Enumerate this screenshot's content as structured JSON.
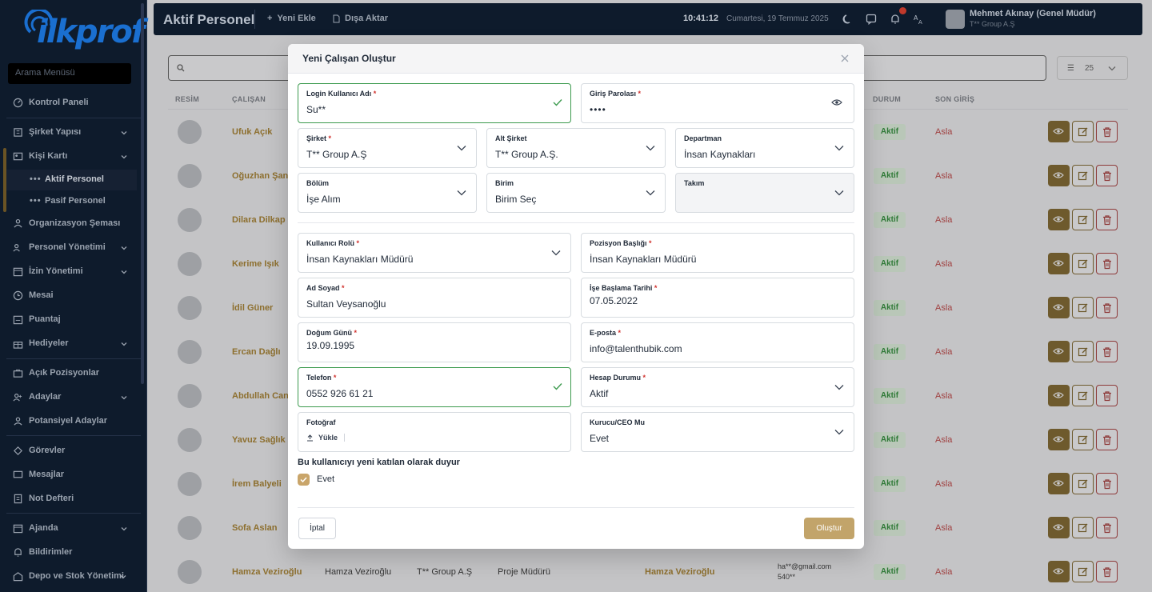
{
  "sidebar": {
    "logo_text": "ilkprof",
    "search_placeholder": "Arama Menüsü",
    "items": [
      {
        "label": "Kontrol Paneli",
        "icon": "dashboard-icon"
      },
      {
        "label": "Şirket Yapısı",
        "icon": "building-icon"
      },
      {
        "label": "Kişi Kartı",
        "icon": "user-card-icon"
      },
      {
        "label": "Aktif Personel"
      },
      {
        "label": "Pasif Personel"
      },
      {
        "label": "Organizasyon Şeması",
        "icon": "org-chart-icon"
      },
      {
        "label": "Personel Yönetimi",
        "icon": "users-icon"
      },
      {
        "label": "İzin Yönetimi",
        "icon": "calendar-icon"
      },
      {
        "label": "Mesai",
        "icon": "clock-icon"
      },
      {
        "label": "Puantaj",
        "icon": "timesheet-icon"
      },
      {
        "label": "Hediyeler",
        "icon": "gift-icon"
      },
      {
        "label": "Açık Pozisyonlar",
        "icon": "briefcase-icon"
      },
      {
        "label": "Adaylar",
        "icon": "candidates-icon"
      },
      {
        "label": "Potansiyel Adaylar",
        "icon": "potential-icon"
      },
      {
        "label": "Görevler",
        "icon": "tasks-icon"
      },
      {
        "label": "Mesajlar",
        "icon": "messages-icon"
      },
      {
        "label": "Not Defteri",
        "icon": "notebook-icon"
      },
      {
        "label": "Ajanda",
        "icon": "agenda-icon"
      },
      {
        "label": "Bildirimler",
        "icon": "bell-icon"
      },
      {
        "label": "Depo ve Stok Yönetimi",
        "icon": "warehouse-icon"
      }
    ]
  },
  "topbar": {
    "title": "Aktif Personel",
    "new_label": "Yeni Ekle",
    "export_label": "Dışa Aktar",
    "time": "10:41:12",
    "date": "Cumartesi, 19 Temmuz 2025",
    "user_name": "Mehmet Akınay (Genel Müdür)",
    "user_company": "T** Group A.Ş"
  },
  "table": {
    "page_size": "25",
    "headers": {
      "photo": "RESİM",
      "employee": "ÇALIŞAN",
      "status": "DURUM",
      "last_login": "SON GİRİŞ"
    },
    "rows": [
      {
        "name": "Ufuk Açık",
        "status": "Aktif",
        "last_login": "Asla"
      },
      {
        "name": "Oğuzhan Şan",
        "status": "Aktif",
        "last_login": "Asla"
      },
      {
        "name": "Dilara Dilkap",
        "status": "Aktif",
        "last_login": "Asla"
      },
      {
        "name": "Kerime Işık",
        "status": "Aktif",
        "last_login": "Asla"
      },
      {
        "name": "İdil Güner",
        "status": "Aktif",
        "last_login": "Asla"
      },
      {
        "name": "Ercan Dağlı",
        "status": "Aktif",
        "last_login": "Asla"
      },
      {
        "name": "Abdullah Can",
        "status": "Aktif",
        "last_login": "Asla"
      },
      {
        "name": "Yavuz Sağlık",
        "status": "Aktif",
        "last_login": "Asla"
      },
      {
        "name": "İrem Balyeli",
        "status": "Aktif",
        "last_login": "Asla"
      },
      {
        "name": "Sofa Aslan",
        "status": "Aktif",
        "last_login": "Asla"
      },
      {
        "name": "Hamza Veziroğlu",
        "status": "Aktif",
        "last_login": "Asla"
      }
    ],
    "last_row": {
      "name2": "Hamza Veziroğlu",
      "company": "T** Group A.Ş",
      "position": "Proje Müdürü",
      "manager": "Hamza Veziroğlu",
      "email": "ha**@gmail.com",
      "phone": "540**"
    }
  },
  "modal": {
    "title": "Yeni Çalışan Oluştur",
    "fields": {
      "login": {
        "label": "Login Kullanıcı Adı",
        "value": "Su**"
      },
      "password": {
        "label": "Giriş Parolası",
        "value": "••••"
      },
      "company": {
        "label": "Şirket",
        "value": "T** Group A.Ş"
      },
      "sub_company": {
        "label": "Alt Şirket",
        "value": "T** Group A.Ş."
      },
      "department": {
        "label": "Departman",
        "value": "İnsan Kaynakları"
      },
      "section": {
        "label": "Bölüm",
        "value": "İşe Alım"
      },
      "unit": {
        "label": "Birim",
        "value": "Birim Seç"
      },
      "team": {
        "label": "Takım",
        "value": ""
      },
      "role": {
        "label": "Kullanıcı Rolü",
        "value": "İnsan Kaynakları Müdürü"
      },
      "position_title": {
        "label": "Pozisyon Başlığı",
        "value": "İnsan Kaynakları Müdürü"
      },
      "full_name": {
        "label": "Ad Soyad",
        "value": "Sultan Veysanoğlu"
      },
      "start_date": {
        "label": "İşe Başlama Tarihi",
        "value": "07.05.2022"
      },
      "birth_date": {
        "label": "Doğum Günü",
        "value": "19.09.1995"
      },
      "email": {
        "label": "E-posta",
        "value": "info@talenthubik.com"
      },
      "phone": {
        "label": "Telefon",
        "value": "0552 926 61 21"
      },
      "account_status": {
        "label": "Hesap Durumu",
        "value": "Aktif"
      },
      "photo": {
        "label": "Fotoğraf",
        "button": "Yükle"
      },
      "founder": {
        "label": "Kurucu/CEO Mu",
        "value": "Evet"
      }
    },
    "required_mark": "*",
    "announce_question": "Bu kullanıcıyı yeni katılan olarak duyur",
    "announce_label": "Evet",
    "announce_checked": true,
    "cancel_label": "İptal",
    "submit_label": "Oluştur"
  },
  "colors": {
    "sidebar_bg": "#0e1b2c",
    "accent_gold": "#c2a46a",
    "success": "#3c9a4e",
    "required": "#d0312d"
  }
}
